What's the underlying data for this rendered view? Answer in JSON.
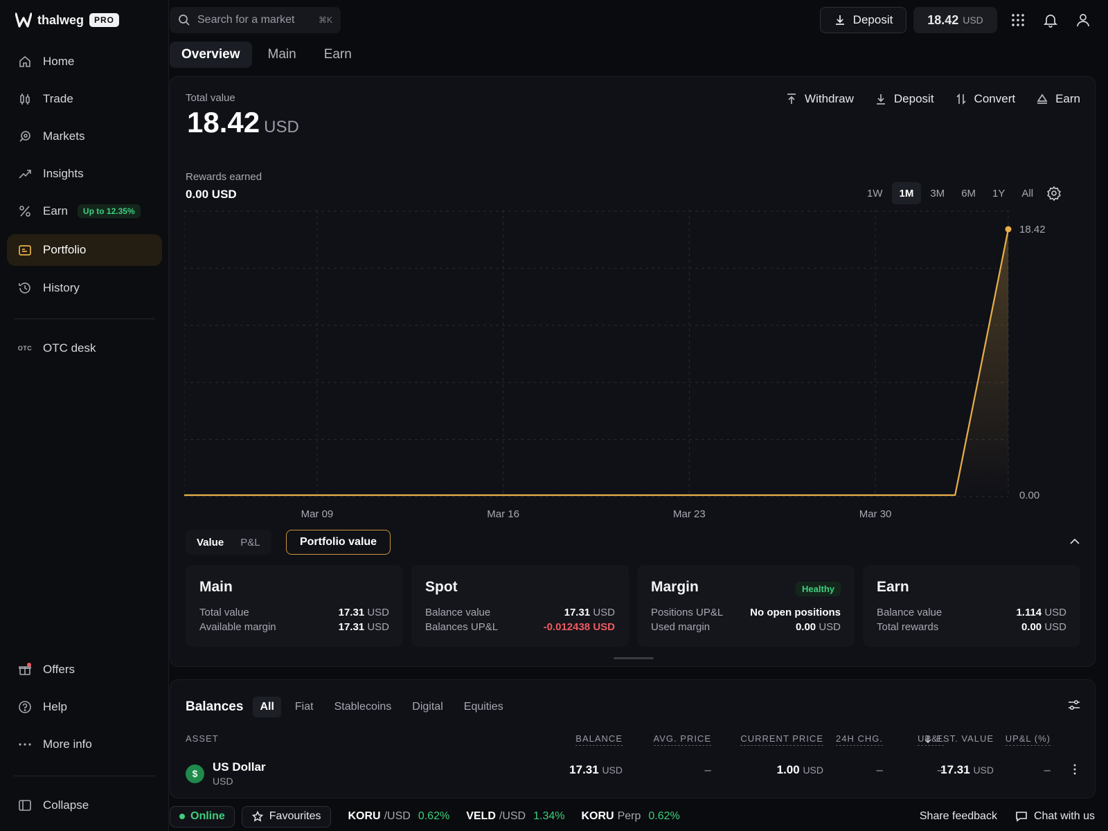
{
  "brand": {
    "name": "thalweg",
    "badge": "PRO"
  },
  "sidebar": {
    "items": [
      {
        "label": "Home"
      },
      {
        "label": "Trade"
      },
      {
        "label": "Markets"
      },
      {
        "label": "Insights"
      },
      {
        "label": "Earn",
        "badge": "Up to 12.35%"
      },
      {
        "label": "Portfolio"
      },
      {
        "label": "History"
      },
      {
        "label": "OTC desk",
        "icon_text": "OTC"
      }
    ],
    "bottom": [
      {
        "label": "Offers"
      },
      {
        "label": "Help"
      },
      {
        "label": "More info"
      },
      {
        "label": "Collapse"
      }
    ]
  },
  "topbar": {
    "search_placeholder": "Search for a market",
    "search_shortcut": "⌘K",
    "deposit_label": "Deposit",
    "balance_value": "18.42",
    "balance_unit": "USD"
  },
  "tabs": [
    {
      "label": "Overview"
    },
    {
      "label": "Main"
    },
    {
      "label": "Earn"
    }
  ],
  "overview": {
    "total_label": "Total value",
    "total_value": "18.42",
    "total_unit": "USD",
    "actions": [
      {
        "label": "Withdraw"
      },
      {
        "label": "Deposit"
      },
      {
        "label": "Convert"
      },
      {
        "label": "Earn"
      }
    ],
    "rewards_label": "Rewards earned",
    "rewards_value": "0.00 USD",
    "ranges": [
      "1W",
      "1M",
      "3M",
      "6M",
      "1Y",
      "All"
    ],
    "active_range": "1M",
    "toggle": [
      "Value",
      "P&L"
    ],
    "portfolio_value_label": "Portfolio value"
  },
  "chart_data": {
    "type": "area",
    "x": [
      "Mar 04",
      "Mar 09",
      "Mar 16",
      "Mar 23",
      "Mar 30",
      "Apr 02",
      "Apr 04"
    ],
    "values": [
      0,
      0,
      0,
      0,
      0,
      0,
      18.42
    ],
    "x_tick_labels": [
      "Mar 09",
      "Mar 16",
      "Mar 23",
      "Mar 30"
    ],
    "y_tick_labels": [
      "18.42",
      "0.00"
    ],
    "ylim": [
      0,
      18.42
    ],
    "grid": true,
    "color": "#e9b04a"
  },
  "cards": [
    {
      "title": "Main",
      "rows": [
        {
          "label": "Total value",
          "value": "17.31",
          "unit": "USD"
        },
        {
          "label": "Available margin",
          "value": "17.31",
          "unit": "USD"
        }
      ]
    },
    {
      "title": "Spot",
      "rows": [
        {
          "label": "Balance value",
          "value": "17.31",
          "unit": "USD"
        },
        {
          "label": "Balances UP&L",
          "value": "-0.012438 USD",
          "unit": ""
        }
      ]
    },
    {
      "title": "Margin",
      "badge": "Healthy",
      "rows": [
        {
          "label": "Positions UP&L",
          "value": "No open positions",
          "unit": ""
        },
        {
          "label": "Used margin",
          "value": "0.00",
          "unit": "USD"
        }
      ]
    },
    {
      "title": "Earn",
      "rows": [
        {
          "label": "Balance value",
          "value": "1.114",
          "unit": "USD"
        },
        {
          "label": "Total rewards",
          "value": "0.00",
          "unit": "USD"
        }
      ]
    }
  ],
  "balances": {
    "title": "Balances",
    "filters": [
      "All",
      "Fiat",
      "Stablecoins",
      "Digital",
      "Equities"
    ],
    "columns": [
      "ASSET",
      "BALANCE",
      "AVG. PRICE",
      "CURRENT PRICE",
      "24H CHG.",
      "EST. VALUE",
      "UP&L",
      "UP&L (%)"
    ],
    "rows": [
      {
        "name": "US Dollar",
        "code": "USD",
        "coin_symbol": "$",
        "balance": "17.31",
        "balance_unit": "USD",
        "avg_price": "–",
        "current_price": "1.00",
        "current_unit": "USD",
        "change": "–",
        "est_value": "17.31",
        "est_unit": "USD",
        "upl": "–",
        "upl_pct": "–"
      }
    ]
  },
  "statusbar": {
    "online": "Online",
    "favourites": "Favourites",
    "tickers": [
      {
        "base": "KORU",
        "quote": "/USD",
        "change": "0.62%"
      },
      {
        "base": "VELD",
        "quote": "/USD",
        "change": "1.34%"
      },
      {
        "base": "KORU",
        "quote": "Perp",
        "change": "0.62%"
      }
    ],
    "feedback": "Share feedback",
    "chat": "Chat with us"
  }
}
